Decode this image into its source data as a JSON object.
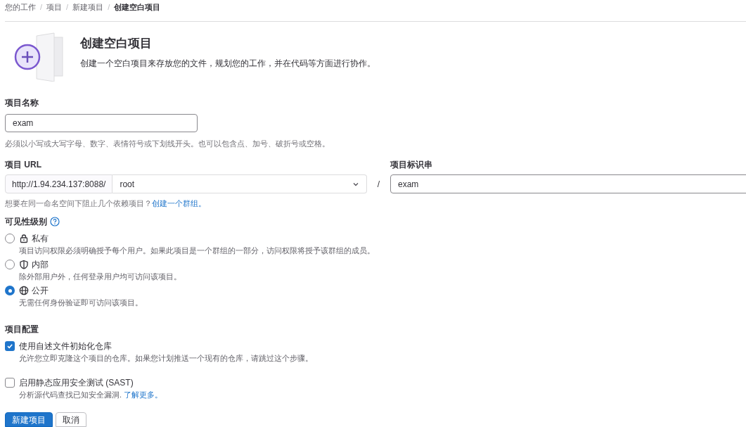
{
  "breadcrumbs": [
    {
      "label": "您的工作",
      "current": false
    },
    {
      "separator": "/",
      "label": "项目",
      "current": false
    },
    {
      "separator": "/",
      "label": "新建项目",
      "current": false
    },
    {
      "separator": "/",
      "label": "创建空白项目",
      "current": true
    }
  ],
  "header": {
    "title": "创建空白项目",
    "description": "创建一个空白项目来存放您的文件，规划您的工作，并在代码等方面进行协作。"
  },
  "project_name": {
    "label": "项目名称",
    "value": "exam",
    "help": "必须以小写或大写字母、数字、表情符号或下划线开头。也可以包含点、加号、破折号或空格。"
  },
  "project_url": {
    "label": "项目 URL",
    "prefix": "http://1.94.234.137:8088/",
    "namespace": "root",
    "separator": "/",
    "help": "想要在同一命名空间下阻止几个依赖项目？",
    "help_link": "创建一个群组。"
  },
  "project_slug": {
    "label": "项目标识串",
    "value": "exam"
  },
  "visibility": {
    "label": "可见性级别",
    "options": [
      {
        "kind": "lock",
        "label": "私有",
        "description": "项目访问权限必须明确授予每个用户。如果此项目是一个群组的一部分，访问权限将授予该群组的成员。",
        "selected": false
      },
      {
        "kind": "shield",
        "label": "内部",
        "description": "除外部用户外，任何登录用户均可访问该项目。",
        "selected": false
      },
      {
        "kind": "globe",
        "label": "公开",
        "description": "无需任何身份验证即可访问该项目。",
        "selected": true
      }
    ]
  },
  "configuration": {
    "label": "项目配置",
    "options": [
      {
        "label": "使用自述文件初始化仓库",
        "description": "允许您立即克隆这个项目的仓库。如果您计划推送一个现有的仓库，请跳过这个步骤。",
        "checked": true
      },
      {
        "label": "启用静态应用安全测试 (SAST)",
        "description": "分析源代码查找已知安全漏洞. ",
        "link": "了解更多。",
        "checked": false
      }
    ]
  },
  "buttons": [
    {
      "kind": "primary",
      "label": "新建项目"
    },
    {
      "kind": "secondary",
      "label": "取消"
    }
  ]
}
